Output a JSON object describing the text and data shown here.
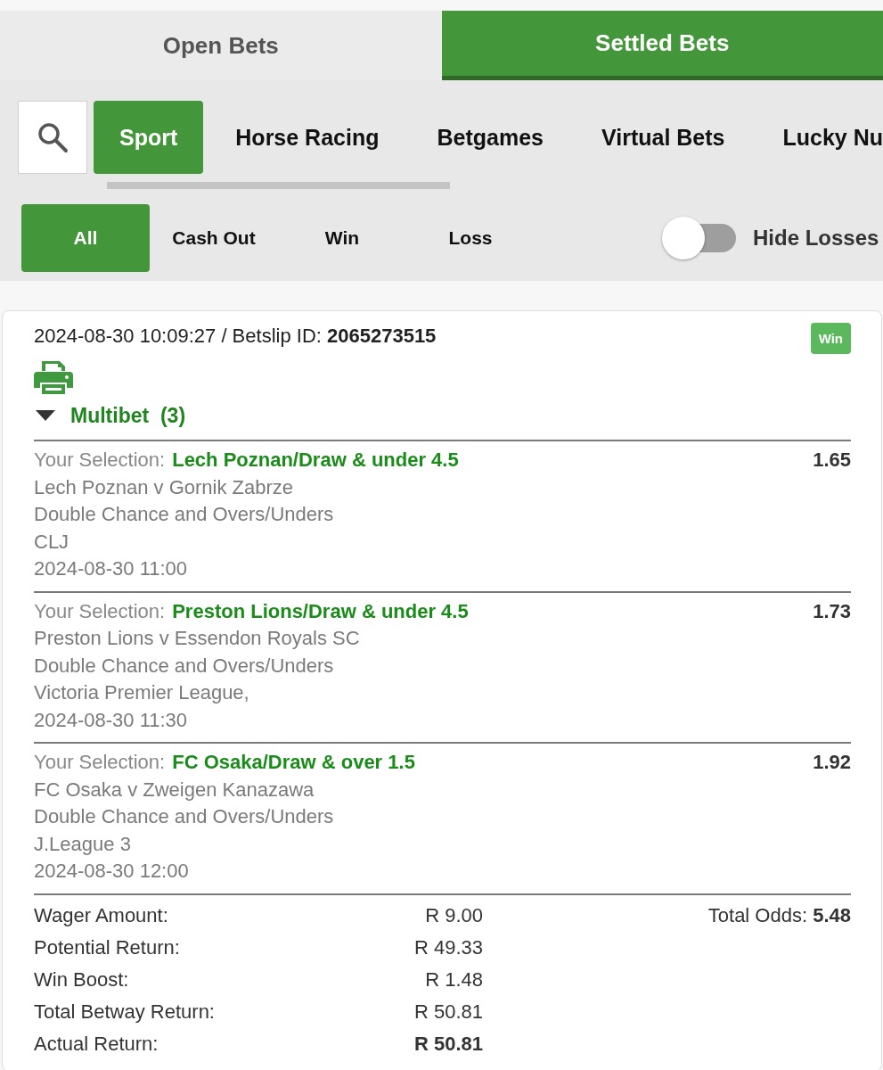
{
  "bet_tabs": [
    {
      "label": "Open Bets",
      "selected": false
    },
    {
      "label": "Settled Bets",
      "selected": true
    }
  ],
  "category_tabs": [
    {
      "label": "Sport",
      "selected": true
    },
    {
      "label": "Horse Racing",
      "selected": false
    },
    {
      "label": "Betgames",
      "selected": false
    },
    {
      "label": "Virtual Bets",
      "selected": false
    },
    {
      "label": "Lucky Nu",
      "selected": false
    }
  ],
  "filters": [
    {
      "label": "All",
      "selected": true
    },
    {
      "label": "Cash Out",
      "selected": false
    },
    {
      "label": "Win",
      "selected": false
    },
    {
      "label": "Loss",
      "selected": false
    }
  ],
  "hide_losses": {
    "label": "Hide Losses",
    "on": false
  },
  "betslip": {
    "header": "2024-08-30 10:09:27 / Betslip ID: **2065273515**",
    "status": "Win",
    "group": {
      "label": "Multibet  (3)",
      "expanded": true
    },
    "selections": [
      {
        "prefix": "Your Selection:",
        "pick": "Lech Poznan/Draw & under 4.5",
        "odds": "1.65",
        "match": "Lech Poznan v Gornik Zabrze",
        "market": "Double Chance and Overs/Unders",
        "league": "CLJ",
        "kickoff": "2024-08-30 11:00"
      },
      {
        "prefix": "Your Selection:",
        "pick": "Preston Lions/Draw & under 4.5",
        "odds": "1.73",
        "match": "Preston Lions v Essendon Royals SC",
        "market": "Double Chance and Overs/Unders",
        "league": "Victoria Premier League,",
        "kickoff": "2024-08-30 11:30"
      },
      {
        "prefix": "Your Selection:",
        "pick": "FC Osaka/Draw & over 1.5",
        "odds": "1.92",
        "match": "FC Osaka v Zweigen Kanazawa",
        "market": "Double Chance and Overs/Unders",
        "league": "J.League 3",
        "kickoff": "2024-08-30 12:00"
      }
    ],
    "summary": [
      {
        "label": "Wager Amount:",
        "value": "R 9.00",
        "emphasis": false
      },
      {
        "label": "Potential Return:",
        "value": "R 49.33",
        "emphasis": false
      },
      {
        "label": "Win Boost:",
        "value": "R 1.48",
        "emphasis": false
      },
      {
        "label": "Total Betway Return:",
        "value": "R 50.81",
        "emphasis": false
      },
      {
        "label": "Actual Return:",
        "value": "R 50.81",
        "emphasis": true
      }
    ],
    "total_odds": "Total Odds: **5.48**"
  }
}
